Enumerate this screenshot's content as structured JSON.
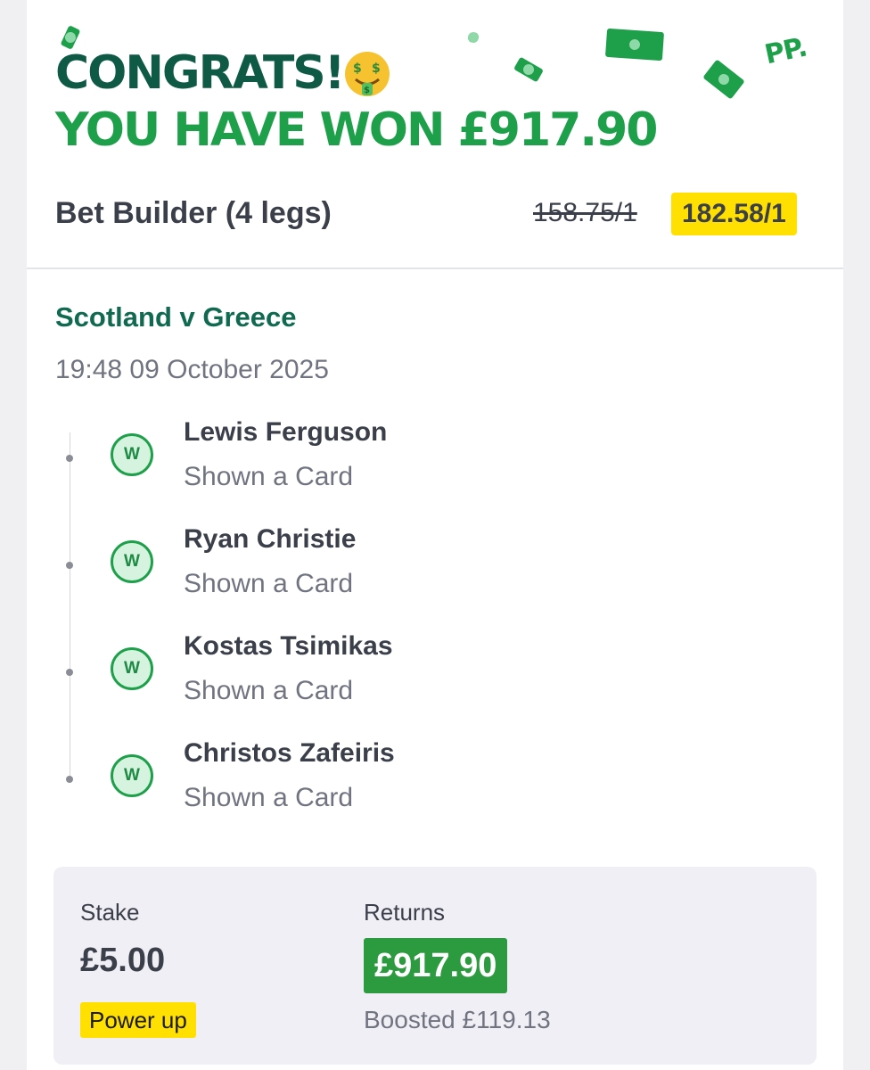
{
  "header": {
    "headline": "CONGRATS!",
    "emoji": "🤑",
    "won_text": "YOU HAVE WON £917.90",
    "logo": "PP.",
    "bet_title": "Bet Builder (4 legs)",
    "old_odds": "158.75/1",
    "new_odds": "182.58/1"
  },
  "event": {
    "match": "Scotland v Greece",
    "datetime": "19:48 09 October 2025"
  },
  "legs": [
    {
      "result": "W",
      "name": "Lewis Ferguson",
      "market": "Shown a Card"
    },
    {
      "result": "W",
      "name": "Ryan Christie",
      "market": "Shown a Card"
    },
    {
      "result": "W",
      "name": "Kostas Tsimikas",
      "market": "Shown a Card"
    },
    {
      "result": "W",
      "name": "Christos Zafeiris",
      "market": "Shown a Card"
    }
  ],
  "summary": {
    "stake_label": "Stake",
    "stake_value": "£5.00",
    "powerup_label": "Power up",
    "returns_label": "Returns",
    "returns_value": "£917.90",
    "boosted_text": "Boosted £119.13"
  },
  "colors": {
    "dark_green": "#0f5a45",
    "bright_green": "#1ea04b",
    "returns_green": "#2c9a3f",
    "highlight_yellow": "#ffe000",
    "text_dark": "#3a3f4a",
    "text_muted": "#707480",
    "summary_bg": "#efeff5"
  },
  "icons": [
    "money-bill-icon",
    "money-mouth-face-emoji",
    "win-badge-icon"
  ]
}
